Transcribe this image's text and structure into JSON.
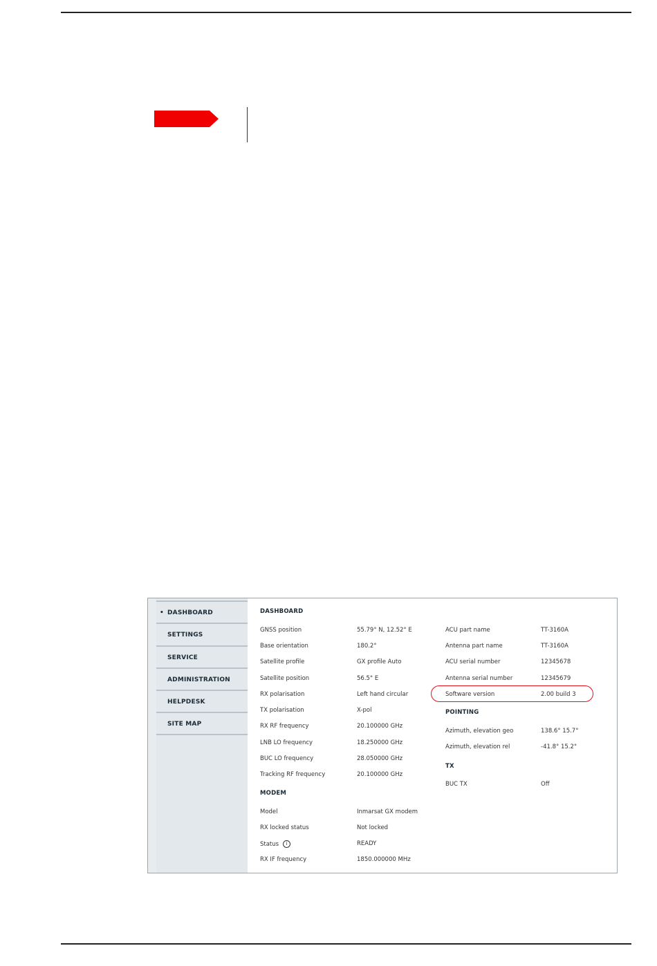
{
  "nav": {
    "bullet": "•",
    "items": [
      {
        "label": "DASHBOARD"
      },
      {
        "label": "SETTINGS"
      },
      {
        "label": "SERVICE"
      },
      {
        "label": "ADMINISTRATION"
      },
      {
        "label": "HELPDESK"
      },
      {
        "label": "SITE MAP"
      }
    ]
  },
  "dashboard": {
    "title": "DASHBOARD",
    "left": [
      {
        "key": "GNSS position",
        "value": "55.79° N, 12.52° E"
      },
      {
        "key": "Base orientation",
        "value": "180.2°"
      },
      {
        "key": "Satellite profile",
        "value": "GX profile Auto"
      },
      {
        "key": "Satellite position",
        "value": "56.5° E"
      },
      {
        "key": "RX polarisation",
        "value": "Left hand circular"
      },
      {
        "key": "TX polarisation",
        "value": "X-pol"
      },
      {
        "key": "RX RF frequency",
        "value": "20.100000 GHz"
      },
      {
        "key": "LNB LO frequency",
        "value": "18.250000 GHz"
      },
      {
        "key": "BUC LO frequency",
        "value": "28.050000 GHz"
      },
      {
        "key": "Tracking RF frequency",
        "value": "20.100000 GHz"
      }
    ],
    "modem_title": "MODEM",
    "modem": [
      {
        "key": "Model",
        "value": "Inmarsat GX modem"
      },
      {
        "key": "RX locked status",
        "value": "Not locked"
      },
      {
        "key": "Status",
        "value": "READY",
        "icon": "info-icon",
        "icon_glyph": "i"
      },
      {
        "key": "RX IF frequency",
        "value": "1850.000000 MHz"
      }
    ],
    "right": [
      {
        "key": "ACU part name",
        "value": "TT-3160A"
      },
      {
        "key": "Antenna part name",
        "value": "TT-3160A"
      },
      {
        "key": "ACU serial number",
        "value": "12345678"
      },
      {
        "key": "Antenna serial number",
        "value": "12345679"
      },
      {
        "key": "Software version",
        "value": "2.00 build 3"
      }
    ],
    "pointing_title": "POINTING",
    "pointing": [
      {
        "key": "Azimuth, elevation geo",
        "value": "138.6° 15.7°"
      },
      {
        "key": "Azimuth, elevation rel",
        "value": "-41.8° 15.2°"
      }
    ],
    "tx_title": "TX",
    "tx": [
      {
        "key": "BUC TX",
        "value": "Off"
      }
    ]
  },
  "colors": {
    "arrow": "#f00000",
    "highlight": "#e0101a"
  }
}
